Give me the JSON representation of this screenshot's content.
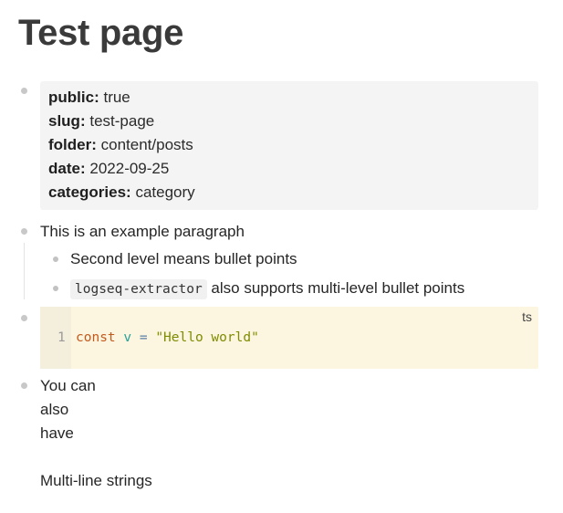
{
  "page": {
    "title": "Test page"
  },
  "properties": [
    {
      "key": "public",
      "value": "true"
    },
    {
      "key": "slug",
      "value": "test-page"
    },
    {
      "key": "folder",
      "value": "content/posts"
    },
    {
      "key": "date",
      "value": "2022-09-25"
    },
    {
      "key": "categories",
      "value": "category"
    }
  ],
  "blocks": {
    "paragraph": {
      "text": "This is an example paragraph",
      "children": [
        {
          "text": "Second level means bullet points"
        },
        {
          "code": "logseq-extractor",
          "text": " also supports multi-level bullet points"
        }
      ]
    },
    "code_block": {
      "language": "ts",
      "line_number": "1",
      "tokens": {
        "keyword": "const",
        "variable": "v",
        "operator": "=",
        "string": "\"Hello world\""
      }
    },
    "multiline": {
      "lines": [
        "You can",
        "also",
        "have",
        "",
        "Multi-line strings"
      ]
    }
  },
  "colors": {
    "bullet": "#c8c8c8",
    "properties_background": "#f4f4f4",
    "code_background": "#fcf5e0",
    "keyword": "#c35a1c",
    "variable": "#2aa198",
    "string": "#7e8c00"
  }
}
